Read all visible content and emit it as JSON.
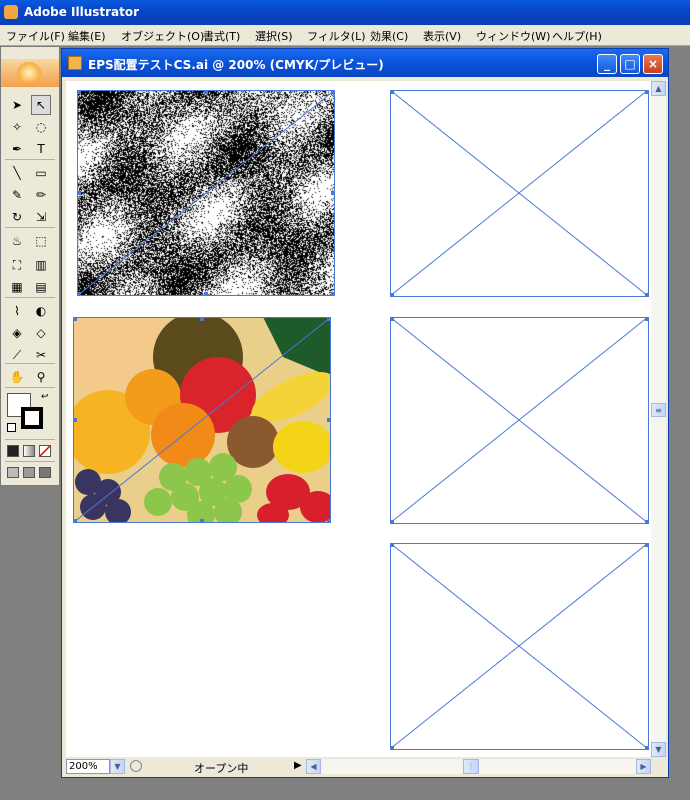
{
  "app": {
    "title": "Adobe Illustrator"
  },
  "menu": [
    "ファイル(F)",
    "編集(E)",
    "オブジェクト(O)",
    "書式(T)",
    "選択(S)",
    "フィルタ(L)",
    "効果(C)",
    "表示(V)",
    "ウィンドウ(W)",
    "ヘルプ(H)"
  ],
  "document": {
    "title": "EPS配置テストCS.ai @ 200% (CMYK/プレビュー)",
    "minimize": "_",
    "maximize": "□",
    "close": "×"
  },
  "status": {
    "zoom": "200%",
    "text": "オープン中"
  },
  "colors": {
    "selection": "#4a78d6",
    "titlebar": "#0a52d8"
  },
  "tools": [
    "selection-arrow-icon",
    "direct-selection-icon",
    "magic-wand-icon",
    "lasso-icon",
    "pen-icon",
    "type-icon",
    "line-icon",
    "rectangle-icon",
    "paintbrush-icon",
    "pencil-icon",
    "rotate-icon",
    "scale-icon",
    "warp-icon",
    "free-transform-icon",
    "symbol-sprayer-icon",
    "graph-icon",
    "mesh-icon",
    "gradient-icon",
    "eyedropper-icon",
    "blend-icon",
    "live-paint-icon",
    "live-paint-select-icon",
    "slice-icon",
    "scissors-icon",
    "hand-icon",
    "zoom-icon"
  ],
  "placed_images": [
    {
      "name": "placed-eps-noise-image"
    },
    {
      "name": "placed-fruit-photo"
    }
  ]
}
